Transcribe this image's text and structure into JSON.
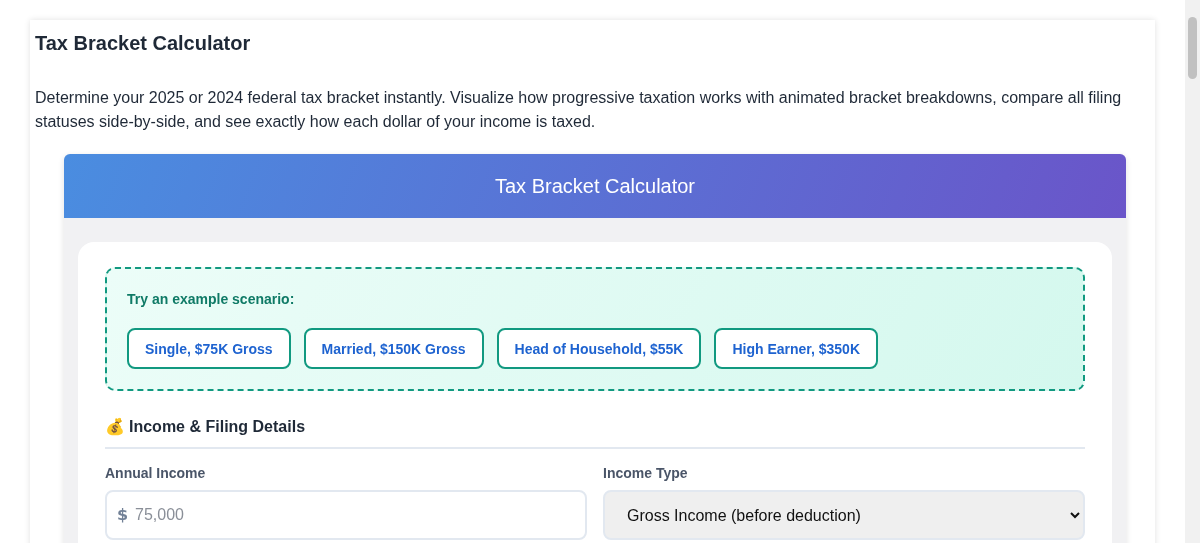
{
  "page": {
    "title": "Tax Bracket Calculator",
    "description": "Determine your 2025 or 2024 federal tax bracket instantly. Visualize how progressive taxation works with animated bracket breakdowns, compare all filing statuses side-by-side, and see exactly how each dollar of your income is taxed."
  },
  "calculator": {
    "title": "Tax Bracket Calculator",
    "examples": {
      "label": "Try an example scenario:",
      "buttons": [
        "Single, $75K Gross",
        "Married, $150K Gross",
        "Head of Household, $55K",
        "High Earner, $350K"
      ]
    },
    "section": {
      "icon": "💰",
      "title": "Income & Filing Details"
    },
    "fields": [
      {
        "kind": "input",
        "label": "Annual Income",
        "prefix": "$",
        "placeholder": "75,000"
      },
      {
        "kind": "select",
        "label": "Income Type",
        "value": "Gross Income (before deduction)"
      }
    ]
  }
}
